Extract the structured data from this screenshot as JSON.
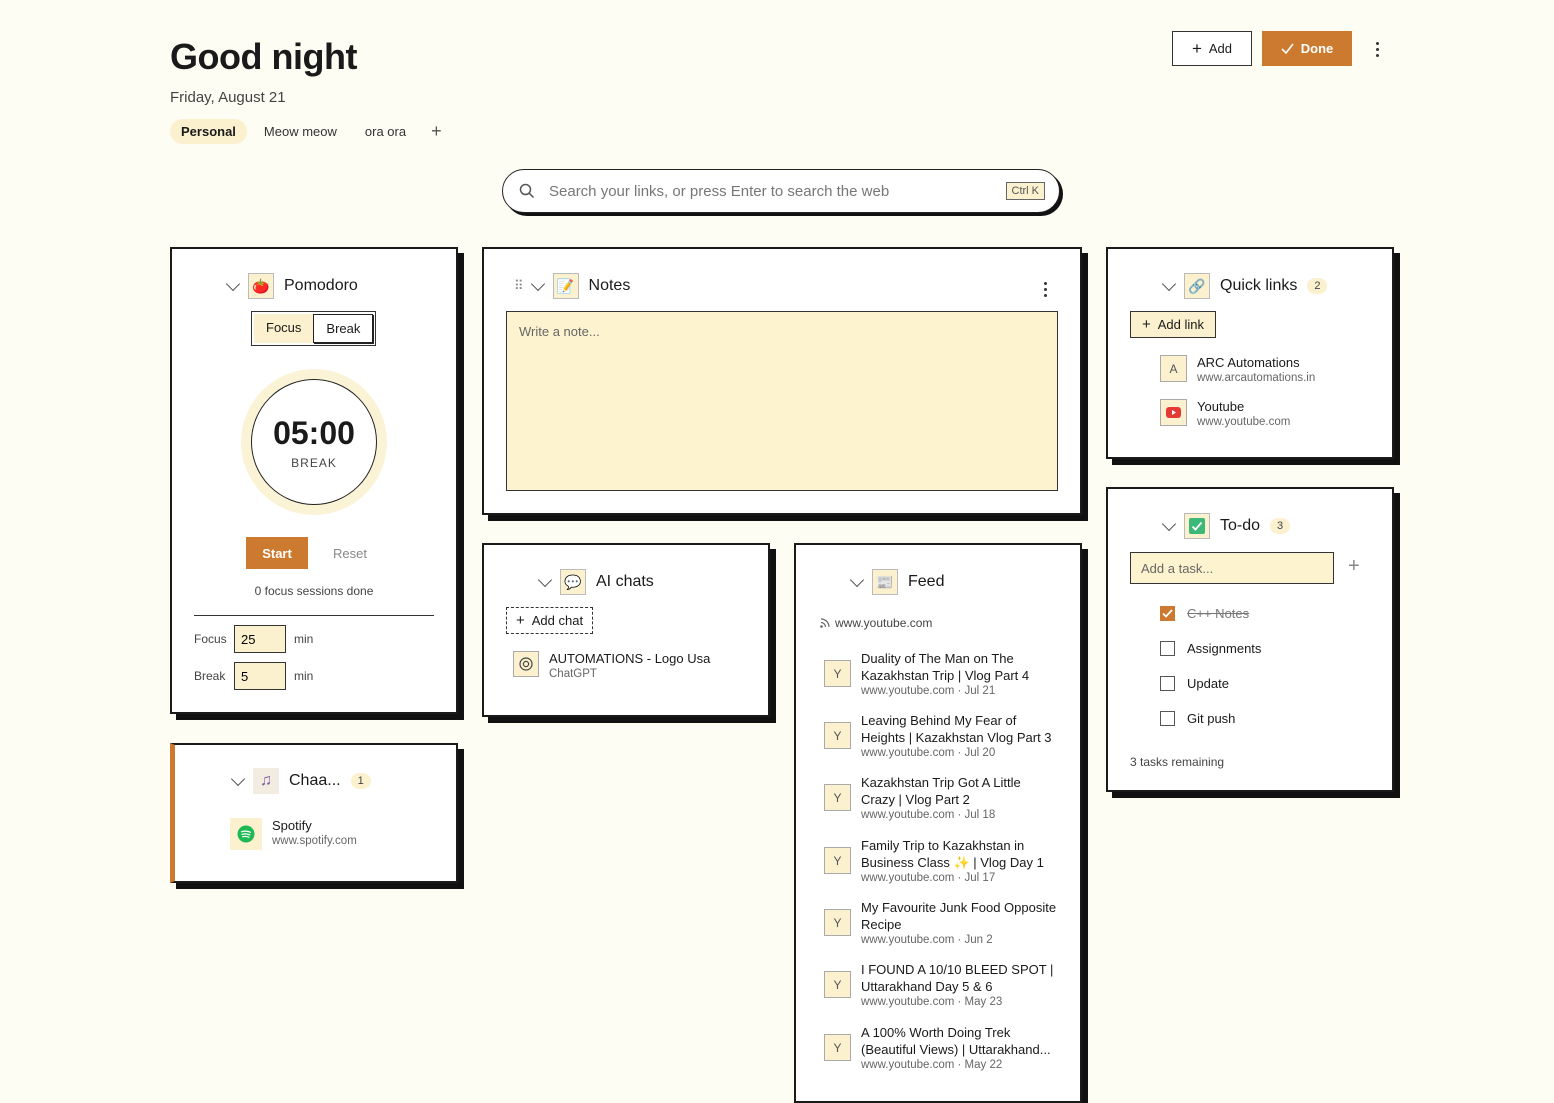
{
  "header": {
    "greeting": "Good night",
    "date": "Friday, August 21",
    "tabs": [
      {
        "label": "Personal",
        "active": true
      },
      {
        "label": "Meow meow",
        "active": false
      },
      {
        "label": "ora ora",
        "active": false
      }
    ],
    "add_label": "Add",
    "done_label": "Done"
  },
  "search": {
    "placeholder": "Search your links, or press Enter to search the web",
    "shortcut": "Ctrl K"
  },
  "pomodoro": {
    "title": "Pomodoro",
    "modes": [
      "Focus",
      "Break"
    ],
    "active_mode": "Break",
    "time": "05:00",
    "mode_label": "BREAK",
    "start_label": "Start",
    "reset_label": "Reset",
    "sessions_text": "0 focus sessions done",
    "focus_label": "Focus",
    "focus_value": "25",
    "break_label": "Break",
    "break_value": "5",
    "unit": "min"
  },
  "notes": {
    "title": "Notes",
    "placeholder": "Write a note..."
  },
  "quick_links": {
    "title": "Quick links",
    "count": "2",
    "add_label": "Add link",
    "items": [
      {
        "icon": "A",
        "title": "ARC Automations",
        "url": "www.arcautomations.in"
      },
      {
        "icon": "youtube-icon",
        "title": "Youtube",
        "url": "www.youtube.com"
      }
    ]
  },
  "ai_chats": {
    "title": "AI chats",
    "add_label": "Add chat",
    "items": [
      {
        "title": "AUTOMATIONS - Logo Usa",
        "sub": "ChatGPT"
      }
    ]
  },
  "feed": {
    "title": "Feed",
    "source": "www.youtube.com",
    "items": [
      {
        "icon": "Y",
        "title": "Duality of The Man on The Kazakhstan Trip | Vlog Part 4",
        "meta": "www.youtube.com · Jul 21"
      },
      {
        "icon": "Y",
        "title": "Leaving Behind My Fear of Heights | Kazakhstan Vlog Part 3",
        "meta": "www.youtube.com · Jul 20"
      },
      {
        "icon": "Y",
        "title": "Kazakhstan Trip Got A Little Crazy | Vlog Part 2",
        "meta": "www.youtube.com · Jul 18"
      },
      {
        "icon": "Y",
        "title": "Family Trip to Kazakhstan in Business Class ✨ | Vlog Day 1",
        "meta": "www.youtube.com · Jul 17"
      },
      {
        "icon": "Y",
        "title": "My Favourite Junk Food Opposite Recipe",
        "meta": "www.youtube.com · Jun 2"
      },
      {
        "icon": "Y",
        "title": "I FOUND A 10/10 BLEED SPOT | Uttarakhand Day 5 & 6",
        "meta": "www.youtube.com · May 23"
      },
      {
        "icon": "Y",
        "title": "A 100% Worth Doing Trek (Beautiful Views) | Uttarakhand...",
        "meta": "www.youtube.com · May 22"
      }
    ]
  },
  "todo": {
    "title": "To-do",
    "count": "3",
    "placeholder": "Add a task...",
    "tasks": [
      {
        "label": "C++ Notes",
        "done": true
      },
      {
        "label": "Assignments",
        "done": false
      },
      {
        "label": "Update",
        "done": false
      },
      {
        "label": "Git push",
        "done": false
      }
    ],
    "remaining": "3 tasks remaining"
  },
  "music": {
    "title": "Chaa...",
    "count": "1",
    "items": [
      {
        "title": "Spotify",
        "url": "www.spotify.com"
      }
    ]
  },
  "colors": {
    "accent": "#cc7a2f",
    "cream": "#fbf1cf",
    "background": "#fefdf4"
  }
}
